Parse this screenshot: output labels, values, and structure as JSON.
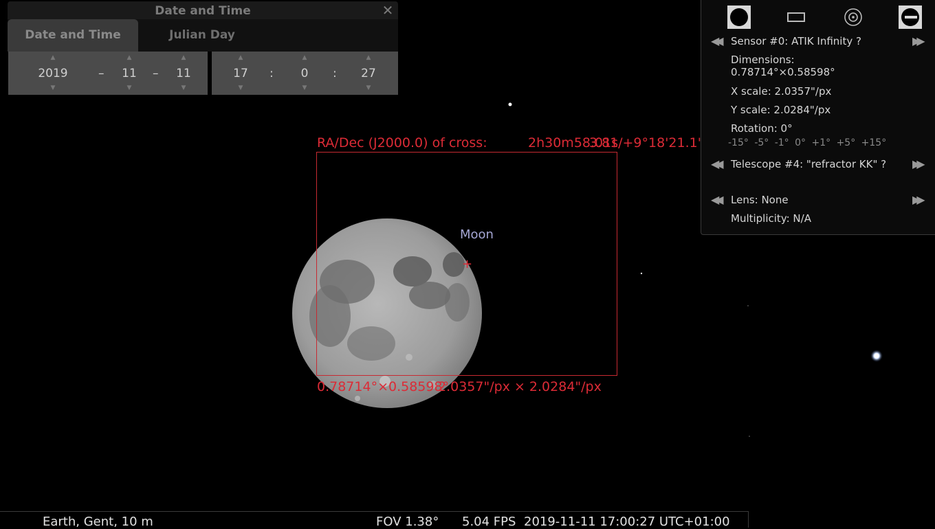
{
  "datetime_dialog": {
    "title": "Date and Time",
    "close_glyph": "✕",
    "tabs": [
      "Date and Time",
      "Julian Day"
    ],
    "date": {
      "year": "2019",
      "month": "11",
      "day": "11"
    },
    "time": {
      "hour": "17",
      "minute": "0",
      "second": "27"
    },
    "separators": {
      "date": "–",
      "time": ":"
    },
    "spin_up": "▲",
    "spin_down": "▼"
  },
  "ocular_panel": {
    "icons": [
      "ocular-view-icon",
      "sensor-frame-icon",
      "telrad-icon",
      "telescope-icon"
    ],
    "prev_glyph": "◀◀",
    "next_glyph": "▶▶",
    "sensor": "Sensor #0: ATIK Infinity ?",
    "dimensions_label": "Dimensions:",
    "dimensions_value": "0.78714°×0.58598°",
    "x_scale": "X scale: 2.0357\"/px",
    "y_scale": "Y scale: 2.0284\"/px",
    "rotation": "Rotation: 0°",
    "rotation_scale": "-15° -5° -1° 0° +1° +5° +15°",
    "telescope": "Telescope #4: \"refractor KK\" ?",
    "lens": "Lens: None",
    "multiplicity": "Multiplicity: N/A"
  },
  "sky_overlay": {
    "radec_label": "RA/Dec (J2000.0) of cross:",
    "radec_value_a": "2h30m58.01s/+9°18'21.1\"",
    "radec_value_b": "3.81",
    "fov_dims": "0.78714°×0.58598°",
    "scale_text": "2.0357\"/px × 2.0284\"/px",
    "object_label": "Moon",
    "cross_glyph": "+"
  },
  "status_bar": {
    "location": "Earth, Gent, 10 m",
    "fov": "FOV 1.38°",
    "fps": "5.04 FPS",
    "datetime": "2019-11-11 17:00:27 UTC+01:00"
  },
  "colors": {
    "overlay_red": "#dc2b36",
    "moon_label": "#a5a7d4",
    "panel_bg": "#0b0b0b"
  }
}
